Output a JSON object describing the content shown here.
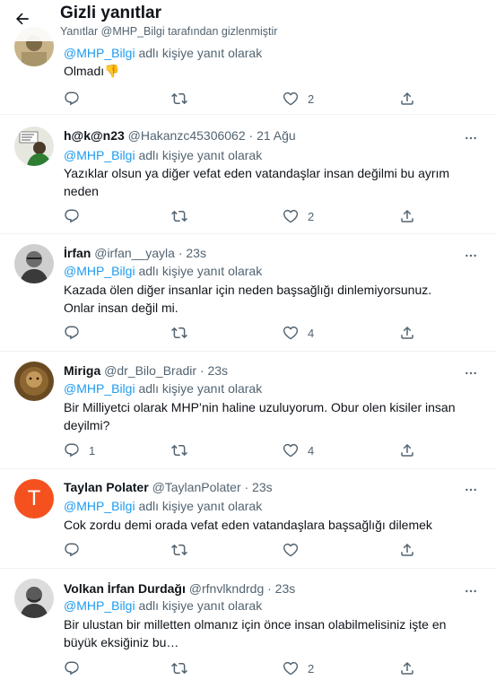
{
  "header": {
    "title": "Gizli yanıtlar",
    "subtitle": "Yanıtlar @MHP_Bilgi tarafından gizlenmiştir",
    "back_icon": "arrow-left-icon"
  },
  "reply_prefix": "adlı kişiye yanıt olarak",
  "reply_target": "@MHP_Bilgi",
  "tweets": [
    {
      "name": "",
      "handle": "",
      "time": "",
      "text": "Olmadı👎",
      "reply_count": "",
      "like_count": "2"
    },
    {
      "name": "h@k@n23",
      "handle": "@Hakanzc45306062",
      "time": "· 21 Ağu",
      "text": "Yazıklar olsun  ya diğer vefat eden vatandaşlar insan değilmi  bu ayrım neden",
      "reply_count": "",
      "like_count": "2"
    },
    {
      "name": "İrfan",
      "handle": "@irfan__yayla",
      "time": "· 23s",
      "text": "Kazada ölen diğer insanlar için neden başsağlığı dinlemiyorsunuz. Onlar insan değil mi.",
      "reply_count": "",
      "like_count": "4"
    },
    {
      "name": "Miriga",
      "handle": "@dr_Bilo_Bradir",
      "time": "· 23s",
      "text": "Bir Milliyetci olarak MHP’nin haline uzuluyorum. Obur olen kisiler insan deyilmi?",
      "reply_count": "1",
      "like_count": "4"
    },
    {
      "name": "Taylan Polater",
      "handle": "@TaylanPolater",
      "time": "· 23s",
      "text": "Cok zordu demi orada vefat eden vatandaşlara başsağlığı dilemek",
      "reply_count": "",
      "like_count": "",
      "avatar_letter": "T"
    },
    {
      "name": "Volkan İrfan Durdağı",
      "handle": "@rfnvlkndrdg",
      "time": "· 23s",
      "text": "Bir ulustan bir milletten olmanız için önce insan olabilmelisiniz işte en büyük eksiğiniz bu…",
      "reply_count": "",
      "like_count": "2"
    }
  ],
  "colors": {
    "accent": "#1d9bf0",
    "text": "#0f1419",
    "secondary": "#536471",
    "divider": "#eff3f4",
    "avatar_orange": "#f4511e"
  }
}
